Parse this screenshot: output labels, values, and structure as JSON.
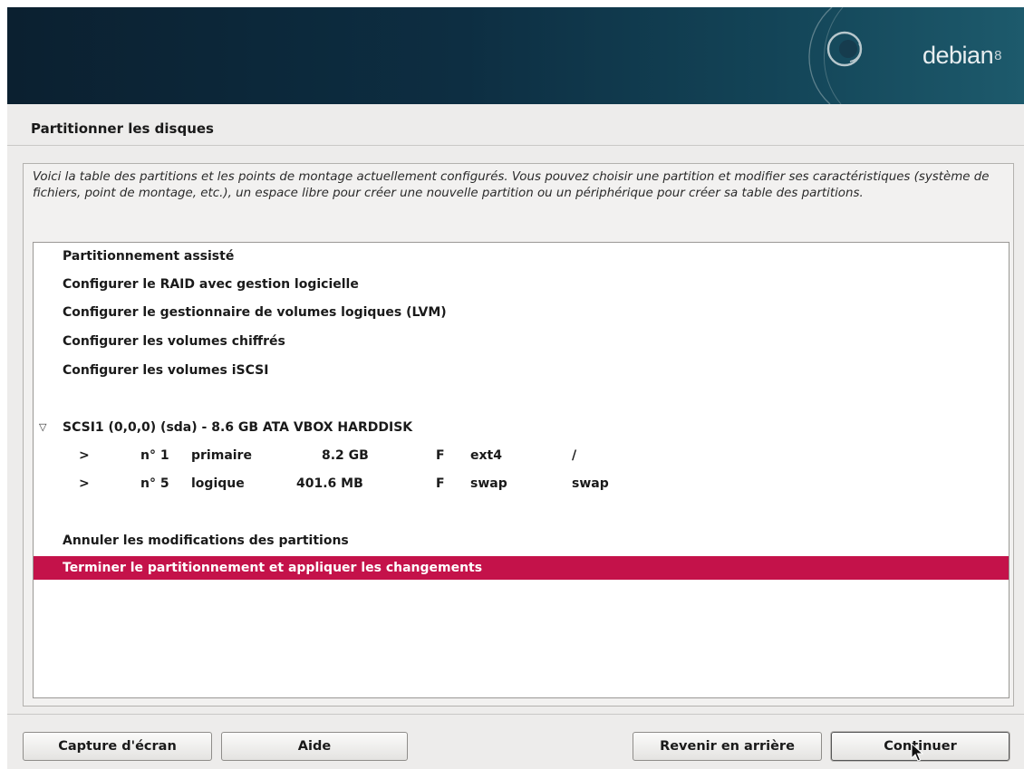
{
  "banner": {
    "brand": "debian",
    "version": "8"
  },
  "page": {
    "title": "Partitionner les disques"
  },
  "description": "Voici la table des partitions et les points de montage actuellement configurés. Vous pouvez choisir une partition et modifier ses caractéristiques (système de fichiers, point de montage, etc.), un espace libre pour créer une nouvelle partition ou un périphérique pour créer sa table des partitions.",
  "menu": {
    "assisted": "Partitionnement assisté",
    "raid": "Configurer le RAID avec gestion logicielle",
    "lvm": "Configurer le gestionnaire de volumes logiques (LVM)",
    "encrypted": "Configurer les volumes chiffrés",
    "iscsi": "Configurer les volumes iSCSI",
    "disk": "SCSI1 (0,0,0) (sda) - 8.6 GB ATA VBOX HARDDISK",
    "undo": "Annuler les modifications des partitions",
    "finish": "Terminer le partitionnement et appliquer les changements"
  },
  "partitions": [
    {
      "arrow": ">",
      "number": "n° 1",
      "type": "primaire",
      "size": "8.2 GB",
      "flag": "F",
      "fs": "ext4",
      "mount": "/"
    },
    {
      "arrow": ">",
      "number": "n° 5",
      "type": "logique",
      "size": "401.6 MB",
      "flag": "F",
      "fs": "swap",
      "mount": "swap"
    }
  ],
  "buttons": {
    "screenshot": "Capture d'écran",
    "help": "Aide",
    "back": "Revenir en arrière",
    "continue": "Continuer"
  },
  "colors": {
    "selection": "#c4124a",
    "banner": "#0d2e42"
  }
}
